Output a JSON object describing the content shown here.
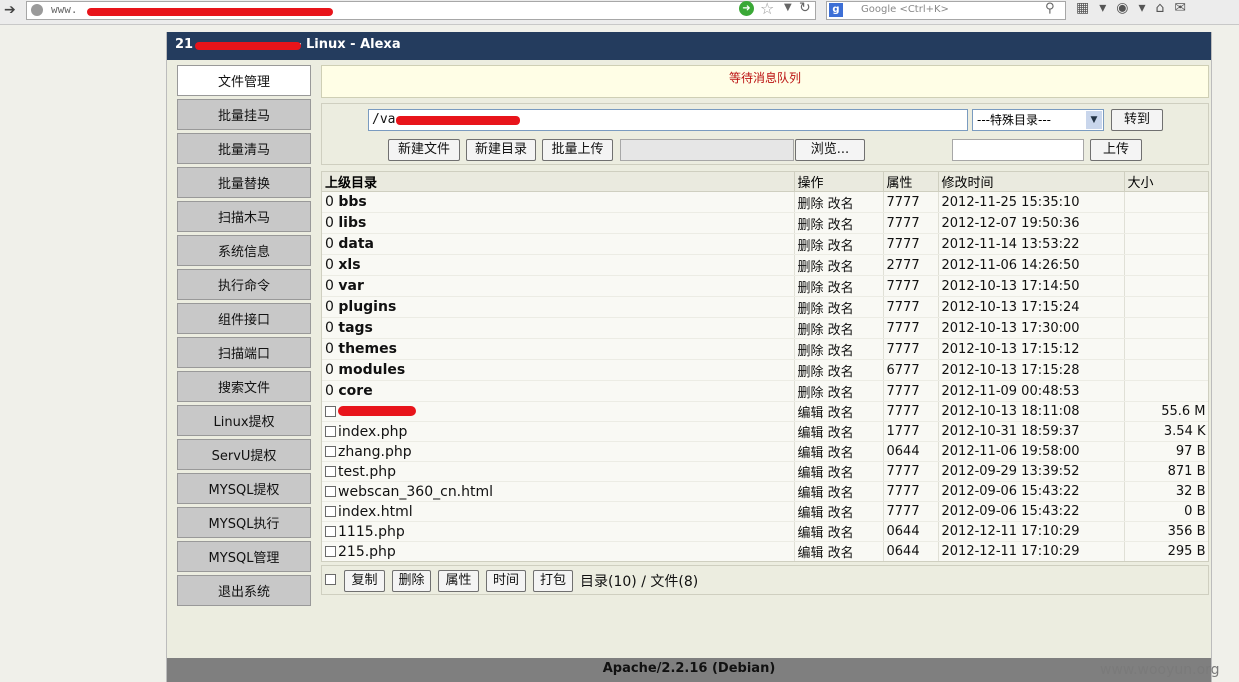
{
  "browser": {
    "url": "www.",
    "search_placeholder": "Google <Ctrl+K>"
  },
  "panel": {
    "title_prefix": "21",
    "title_suffix": "- Linux - Alexa",
    "message": "等待消息队列",
    "footer": "Apache/2.2.16 (Debian)",
    "watermark": "www.wooyun.org"
  },
  "sidebar": {
    "items": [
      {
        "label": "文件管理",
        "active": true
      },
      {
        "label": "批量挂马"
      },
      {
        "label": "批量清马"
      },
      {
        "label": "批量替换"
      },
      {
        "label": "扫描木马"
      },
      {
        "label": "系统信息"
      },
      {
        "label": "执行命令"
      },
      {
        "label": "组件接口"
      },
      {
        "label": "扫描端口"
      },
      {
        "label": "搜索文件"
      },
      {
        "label": "Linux提权"
      },
      {
        "label": "ServU提权"
      },
      {
        "label": "MYSQL提权"
      },
      {
        "label": "MYSQL执行"
      },
      {
        "label": "MYSQL管理"
      },
      {
        "label": "退出系统"
      }
    ]
  },
  "tools": {
    "path_value": "/va",
    "special_dir": "---特殊目录---",
    "goto": "转到",
    "new_file": "新建文件",
    "new_dir": "新建目录",
    "batch_upload": "批量上传",
    "browse": "浏览...",
    "upload": "上传"
  },
  "table": {
    "headers": [
      "上级目录",
      "操作",
      "属性",
      "修改时间",
      "大小"
    ],
    "dirs": [
      {
        "prefix": "0",
        "name": "bbs",
        "op1": "删除",
        "op2": "改名",
        "attr": "7777",
        "time": "2012-11-25 15:35:10"
      },
      {
        "prefix": "0",
        "name": "libs",
        "op1": "删除",
        "op2": "改名",
        "attr": "7777",
        "time": "2012-12-07 19:50:36"
      },
      {
        "prefix": "0",
        "name": "data",
        "op1": "删除",
        "op2": "改名",
        "attr": "7777",
        "time": "2012-11-14 13:53:22"
      },
      {
        "prefix": "0",
        "name": "xls",
        "op1": "删除",
        "op2": "改名",
        "attr": "2777",
        "time": "2012-11-06 14:26:50"
      },
      {
        "prefix": "0",
        "name": "var",
        "op1": "删除",
        "op2": "改名",
        "attr": "7777",
        "time": "2012-10-13 17:14:50"
      },
      {
        "prefix": "0",
        "name": "plugins",
        "op1": "删除",
        "op2": "改名",
        "attr": "7777",
        "time": "2012-10-13 17:15:24"
      },
      {
        "prefix": "0",
        "name": "tags",
        "op1": "删除",
        "op2": "改名",
        "attr": "7777",
        "time": "2012-10-13 17:30:00"
      },
      {
        "prefix": "0",
        "name": "themes",
        "op1": "删除",
        "op2": "改名",
        "attr": "7777",
        "time": "2012-10-13 17:15:12"
      },
      {
        "prefix": "0",
        "name": "modules",
        "op1": "删除",
        "op2": "改名",
        "attr": "6777",
        "time": "2012-10-13 17:15:28"
      },
      {
        "prefix": "0",
        "name": "core",
        "op1": "删除",
        "op2": "改名",
        "attr": "7777",
        "time": "2012-11-09 00:48:53"
      }
    ],
    "files": [
      {
        "name": "",
        "redacted": true,
        "op1": "编辑",
        "op2": "改名",
        "attr": "7777",
        "time": "2012-10-13 18:11:08",
        "size": "55.6 M"
      },
      {
        "name": "index.php",
        "op1": "编辑",
        "op2": "改名",
        "attr": "1777",
        "time": "2012-10-31 18:59:37",
        "size": "3.54 K"
      },
      {
        "name": "zhang.php",
        "op1": "编辑",
        "op2": "改名",
        "attr": "0644",
        "time": "2012-11-06 19:58:00",
        "size": "97 B"
      },
      {
        "name": "test.php",
        "op1": "编辑",
        "op2": "改名",
        "attr": "7777",
        "time": "2012-09-29 13:39:52",
        "size": "871 B"
      },
      {
        "name": "webscan_360_cn.html",
        "op1": "编辑",
        "op2": "改名",
        "attr": "7777",
        "time": "2012-09-06 15:43:22",
        "size": "32 B"
      },
      {
        "name": "index.html",
        "op1": "编辑",
        "op2": "改名",
        "attr": "7777",
        "time": "2012-09-06 15:43:22",
        "size": "0 B"
      },
      {
        "name": "1115.php",
        "op1": "编辑",
        "op2": "改名",
        "attr": "0644",
        "time": "2012-12-11 17:10:29",
        "size": "356 B"
      },
      {
        "name": "215.php",
        "op1": "编辑",
        "op2": "改名",
        "attr": "0644",
        "time": "2012-12-11 17:10:29",
        "size": "295 B"
      }
    ]
  },
  "actions": {
    "copy": "复制",
    "delete": "删除",
    "attr": "属性",
    "time": "时间",
    "pack": "打包",
    "summary": "目录(10) / 文件(8)"
  }
}
